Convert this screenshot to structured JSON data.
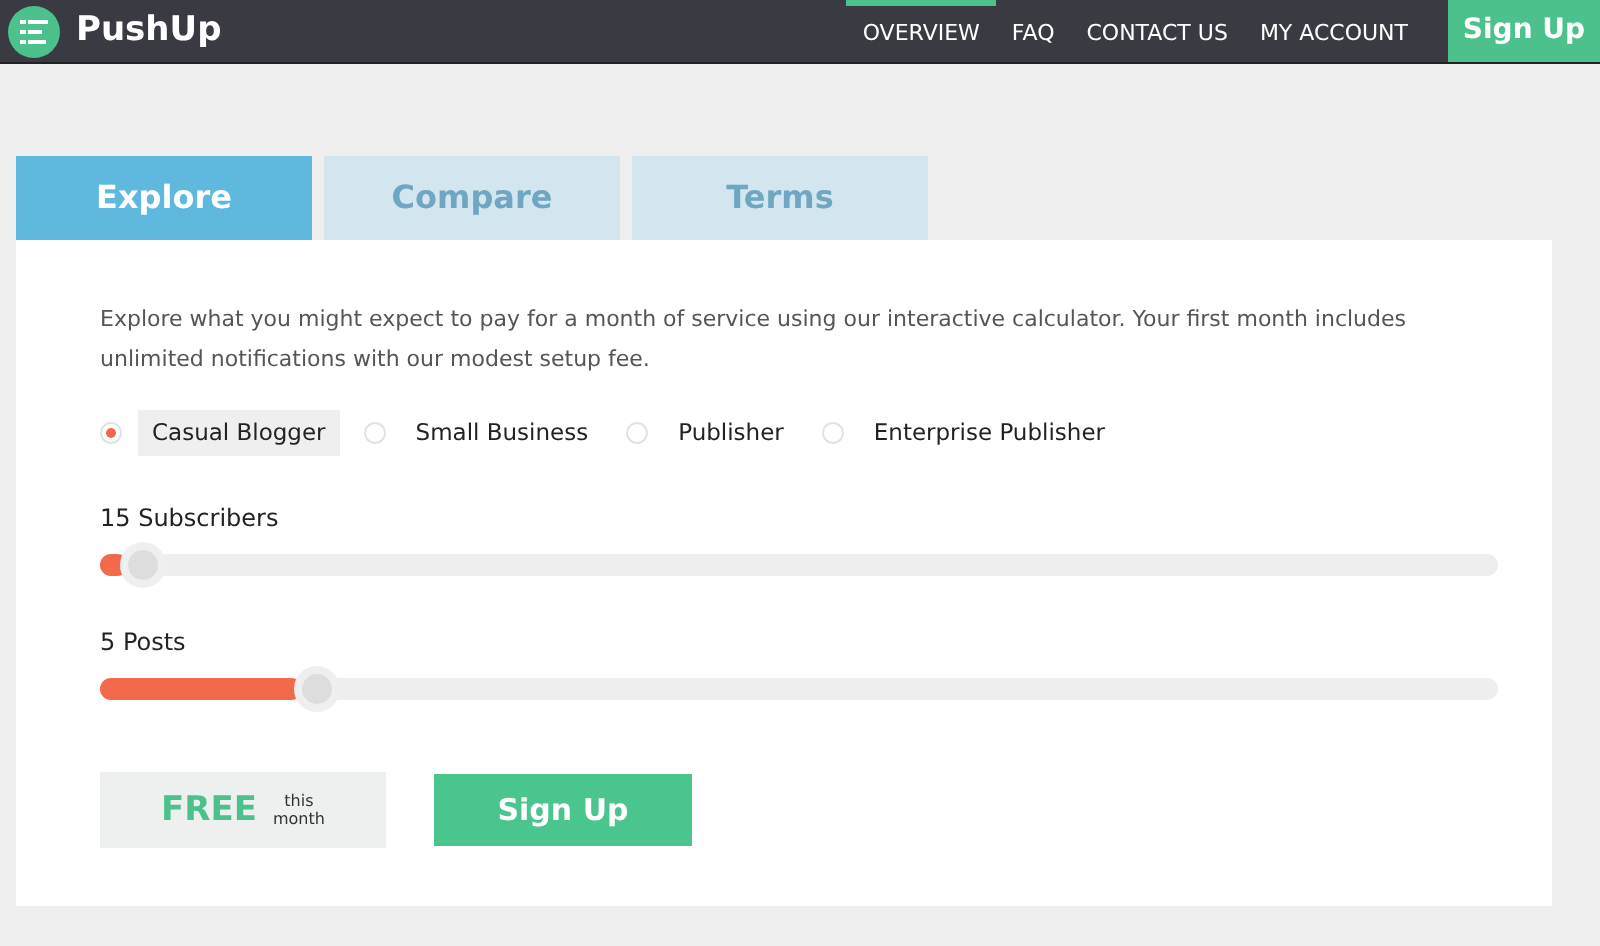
{
  "nav": {
    "brand": "PushUp",
    "links": [
      {
        "label": "OVERVIEW",
        "selected": true
      },
      {
        "label": "FAQ",
        "selected": false
      },
      {
        "label": "CONTACT US",
        "selected": false
      },
      {
        "label": "MY ACCOUNT",
        "selected": false
      }
    ],
    "signup": "Sign Up"
  },
  "tabs": [
    {
      "label": "Explore",
      "selected": true
    },
    {
      "label": "Compare",
      "selected": false
    },
    {
      "label": "Terms",
      "selected": false
    }
  ],
  "intro": "Explore what you might expect to pay for a month of service using our interactive calculator. Your first month includes unlimited notifications with our modest setup fee.",
  "plans": [
    {
      "label": "Casual Blogger",
      "selected": true
    },
    {
      "label": "Small Business",
      "selected": false
    },
    {
      "label": "Publisher",
      "selected": false
    },
    {
      "label": "Enterprise Publisher",
      "selected": false
    }
  ],
  "sliders": [
    {
      "label": "15 Subscribers",
      "level": 0.02
    },
    {
      "label": "5 Posts",
      "level": 0.145
    }
  ],
  "price": {
    "amount": "FREE",
    "note_1": "this",
    "note_2": "month"
  },
  "signup": "Sign Up"
}
